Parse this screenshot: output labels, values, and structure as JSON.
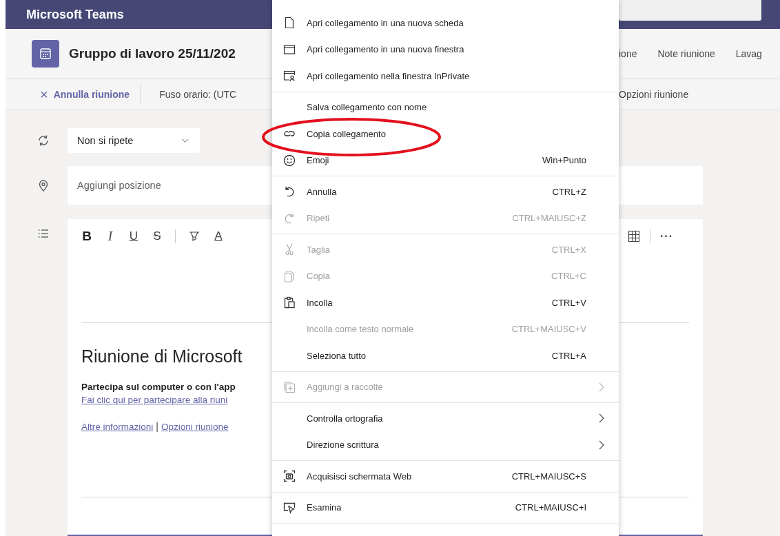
{
  "window": {
    "title": "Microsoft Teams"
  },
  "header": {
    "title": "Gruppo di lavoro 25/11/202",
    "tabs": [
      {
        "label": "ione"
      },
      {
        "label": "Note riunione"
      },
      {
        "label": "Lavag"
      }
    ]
  },
  "toolbar": {
    "cancel": "Annulla riunione",
    "cancel_icon": "×",
    "timezone": "Fuso orario: (UTC",
    "options": "Opzioni riunione"
  },
  "repeat": {
    "value": "Non si ripete"
  },
  "location": {
    "placeholder": "Aggiungi posizione"
  },
  "editor": {
    "format_buttons": [
      {
        "label": "B",
        "kind": "bold"
      },
      {
        "label": "I",
        "kind": "italic"
      },
      {
        "label": "U",
        "kind": "underline"
      },
      {
        "label": "S",
        "kind": "strike"
      },
      {
        "label": "A",
        "kind": "color"
      }
    ],
    "heading": "Riunione di Microsoft",
    "join_text": "Partecipa sul computer o con l'app",
    "join_link": "Fai clic qui per partecipare alla riuni",
    "more_link": "Altre informazioni",
    "separator": "|",
    "options_link": "Opzioni riunione",
    "more_icon": "···"
  },
  "context_menu": {
    "sections": [
      [
        {
          "label": "Apri collegamento in una nuova scheda",
          "disabled": false,
          "submenu": false
        },
        {
          "label": "Apri collegamento in una nuova finestra",
          "disabled": false,
          "submenu": false
        },
        {
          "label": "Apri collegamento nella finestra InPrivate",
          "disabled": false,
          "submenu": false
        }
      ],
      [
        {
          "label": "Salva collegamento con nome",
          "disabled": false,
          "submenu": false
        },
        {
          "label": "Copia collegamento",
          "disabled": false,
          "submenu": false
        },
        {
          "label": "Emoji",
          "shortcut": "Win+Punto",
          "disabled": false,
          "submenu": false
        }
      ],
      [
        {
          "label": "Annulla",
          "shortcut": "CTRL+Z",
          "disabled": false,
          "submenu": false
        },
        {
          "label": "Ripeti",
          "shortcut": "CTRL+MAIUSC+Z",
          "disabled": true,
          "submenu": false
        }
      ],
      [
        {
          "label": "Taglia",
          "shortcut": "CTRL+X",
          "disabled": true,
          "submenu": false
        },
        {
          "label": "Copia",
          "shortcut": "CTRL+C",
          "disabled": true,
          "submenu": false
        },
        {
          "label": "Incolla",
          "shortcut": "CTRL+V",
          "disabled": false,
          "submenu": false
        },
        {
          "label": "Incolla come testo normale",
          "shortcut": "CTRL+MAIUSC+V",
          "disabled": true,
          "submenu": false
        },
        {
          "label": "Seleziona tutto",
          "shortcut": "CTRL+A",
          "disabled": false,
          "submenu": false
        }
      ],
      [
        {
          "label": "Aggiungi a raccolte",
          "disabled": true,
          "submenu": true
        }
      ],
      [
        {
          "label": "Controlla ortografia",
          "disabled": false,
          "submenu": true
        },
        {
          "label": "Direzione scrittura",
          "disabled": false,
          "submenu": true
        }
      ],
      [
        {
          "label": "Acquisisci schermata Web",
          "shortcut": "CTRL+MAIUSC+S",
          "disabled": false,
          "submenu": false
        }
      ],
      [
        {
          "label": "Esamina",
          "shortcut": "CTRL+MAIUSC+I",
          "disabled": false,
          "submenu": false
        }
      ]
    ]
  }
}
